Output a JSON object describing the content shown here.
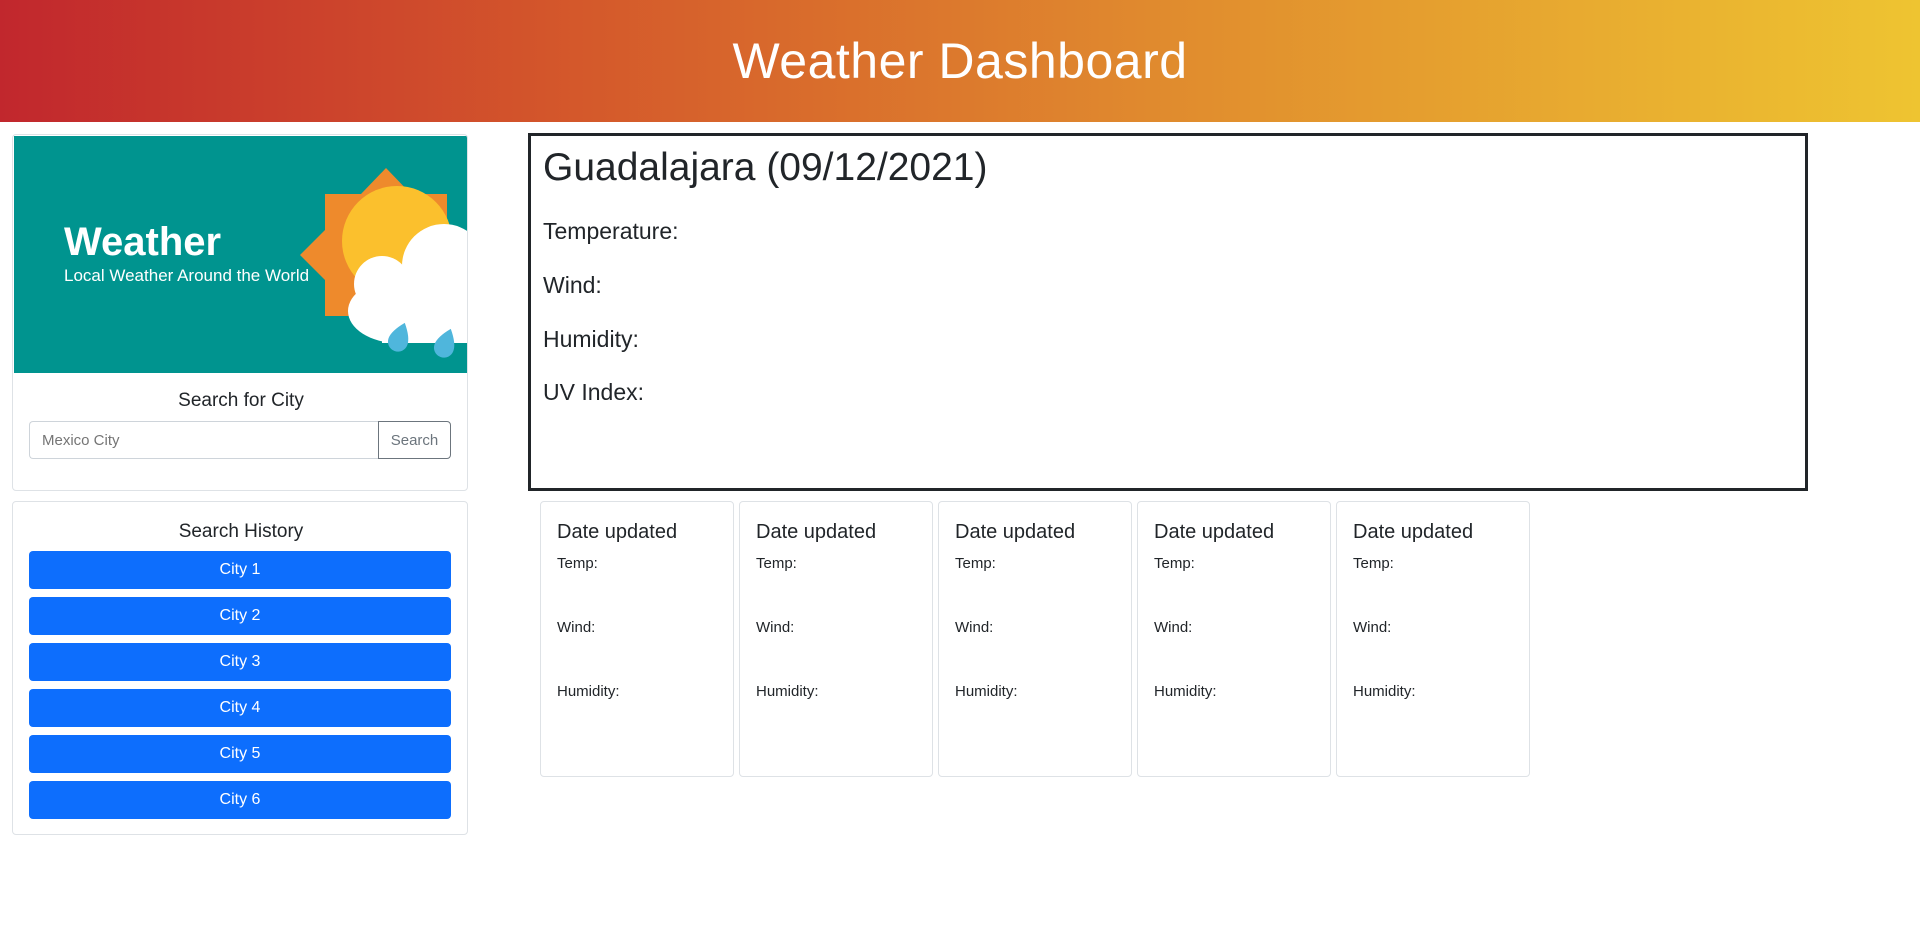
{
  "header": {
    "title": "Weather Dashboard"
  },
  "banner": {
    "title": "Weather",
    "subtitle": "Local Weather Around the World"
  },
  "search": {
    "title": "Search for City",
    "placeholder": "Mexico City",
    "button_label": "Search"
  },
  "history": {
    "title": "Search History",
    "cities": [
      "City 1",
      "City 2",
      "City 3",
      "City 4",
      "City 5",
      "City 6"
    ]
  },
  "current": {
    "heading": "Guadalajara (09/12/2021)",
    "temperature_label": "Temperature:",
    "wind_label": "Wind:",
    "humidity_label": "Humidity:",
    "uv_label": "UV Index:"
  },
  "forecast": [
    {
      "date": "Date updated",
      "temp": "Temp:",
      "wind": "Wind:",
      "humidity": "Humidity:"
    },
    {
      "date": "Date updated",
      "temp": "Temp:",
      "wind": "Wind:",
      "humidity": "Humidity:"
    },
    {
      "date": "Date updated",
      "temp": "Temp:",
      "wind": "Wind:",
      "humidity": "Humidity:"
    },
    {
      "date": "Date updated",
      "temp": "Temp:",
      "wind": "Wind:",
      "humidity": "Humidity:"
    },
    {
      "date": "Date updated",
      "temp": "Temp:",
      "wind": "Wind:",
      "humidity": "Humidity:"
    }
  ],
  "colors": {
    "header_gradient_start": "#c1272d",
    "header_gradient_end": "#eec431",
    "banner_bg": "#00948f",
    "history_button": "#0d6efd"
  }
}
